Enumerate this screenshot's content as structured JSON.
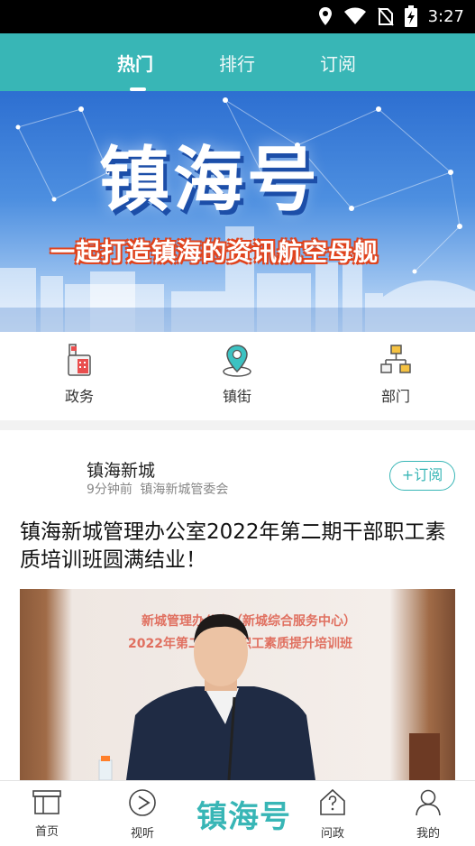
{
  "status_bar": {
    "time": "3:27",
    "icons": [
      "location-icon",
      "wifi-icon",
      "no-sim-icon",
      "battery-charging-icon"
    ]
  },
  "tabs": [
    {
      "label": "热门",
      "active": true
    },
    {
      "label": "排行",
      "active": false
    },
    {
      "label": "订阅",
      "active": false
    }
  ],
  "banner": {
    "title": "镇海号",
    "slogan": "一起打造镇海的资讯航空母舰"
  },
  "quick_nav": [
    {
      "label": "政务",
      "icon": "government-building-icon"
    },
    {
      "label": "镇街",
      "icon": "map-pin-icon"
    },
    {
      "label": "部门",
      "icon": "org-chart-icon"
    }
  ],
  "article": {
    "author": "镇海新城",
    "time_ago": "9分钟前",
    "source": "镇海新城管委会",
    "subscribe_label": "+订阅",
    "title": "镇海新城管理办公室2022年第二期干部职工素质培训班圆满结业！",
    "photo_caption_1": "新城管理办公室（新城综合服务中心）",
    "photo_caption_2": "2022年第二期干部职工素质提升培训班"
  },
  "bottom_nav": [
    {
      "label": "首页",
      "icon": "home-icon"
    },
    {
      "label": "视听",
      "icon": "play-icon"
    },
    {
      "label": "镇海号",
      "icon": "logo"
    },
    {
      "label": "问政",
      "icon": "question-icon"
    },
    {
      "label": "我的",
      "icon": "user-icon"
    }
  ],
  "colors": {
    "accent": "#38b6b6",
    "banner_blue": "#2d6fd1",
    "slogan_red": "#e0431d"
  }
}
